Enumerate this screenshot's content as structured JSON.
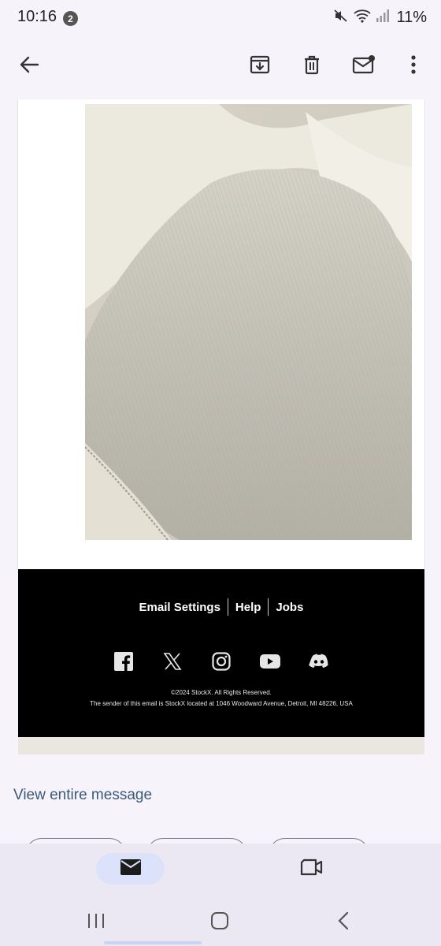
{
  "status_bar": {
    "time": "10:16",
    "notification_count": "2",
    "battery": "11%",
    "icons": [
      "mute-icon",
      "wifi-icon",
      "signal-icon"
    ]
  },
  "toolbar": {
    "icons": [
      "back-arrow-icon",
      "archive-icon",
      "delete-icon",
      "mark-unread-icon",
      "more-vert-icon"
    ]
  },
  "email": {
    "image_alt": "close-up of cream knit fabric",
    "footer": {
      "links": [
        "Email Settings",
        "Help",
        "Jobs"
      ],
      "social_icons": [
        "facebook-icon",
        "x-icon",
        "instagram-icon",
        "youtube-icon",
        "discord-icon"
      ],
      "copyright": "©2024 StockX. All Rights Reserved.",
      "sender": "The sender of this email is StockX located at 1046 Woodward Avenue, Detroit, MI 48226, USA"
    }
  },
  "view_entire_message": "View entire message",
  "bottom_nav": {
    "items": [
      {
        "icon": "mail-icon",
        "active": true
      },
      {
        "icon": "meet-video-icon",
        "active": false
      }
    ]
  },
  "system_nav": [
    "recents-icon",
    "home-icon",
    "back-icon"
  ],
  "colors": {
    "background": "#f6f3fb",
    "footer_bg": "#000000",
    "link": "#3a5a78",
    "nav_active": "#dbe2f9"
  }
}
